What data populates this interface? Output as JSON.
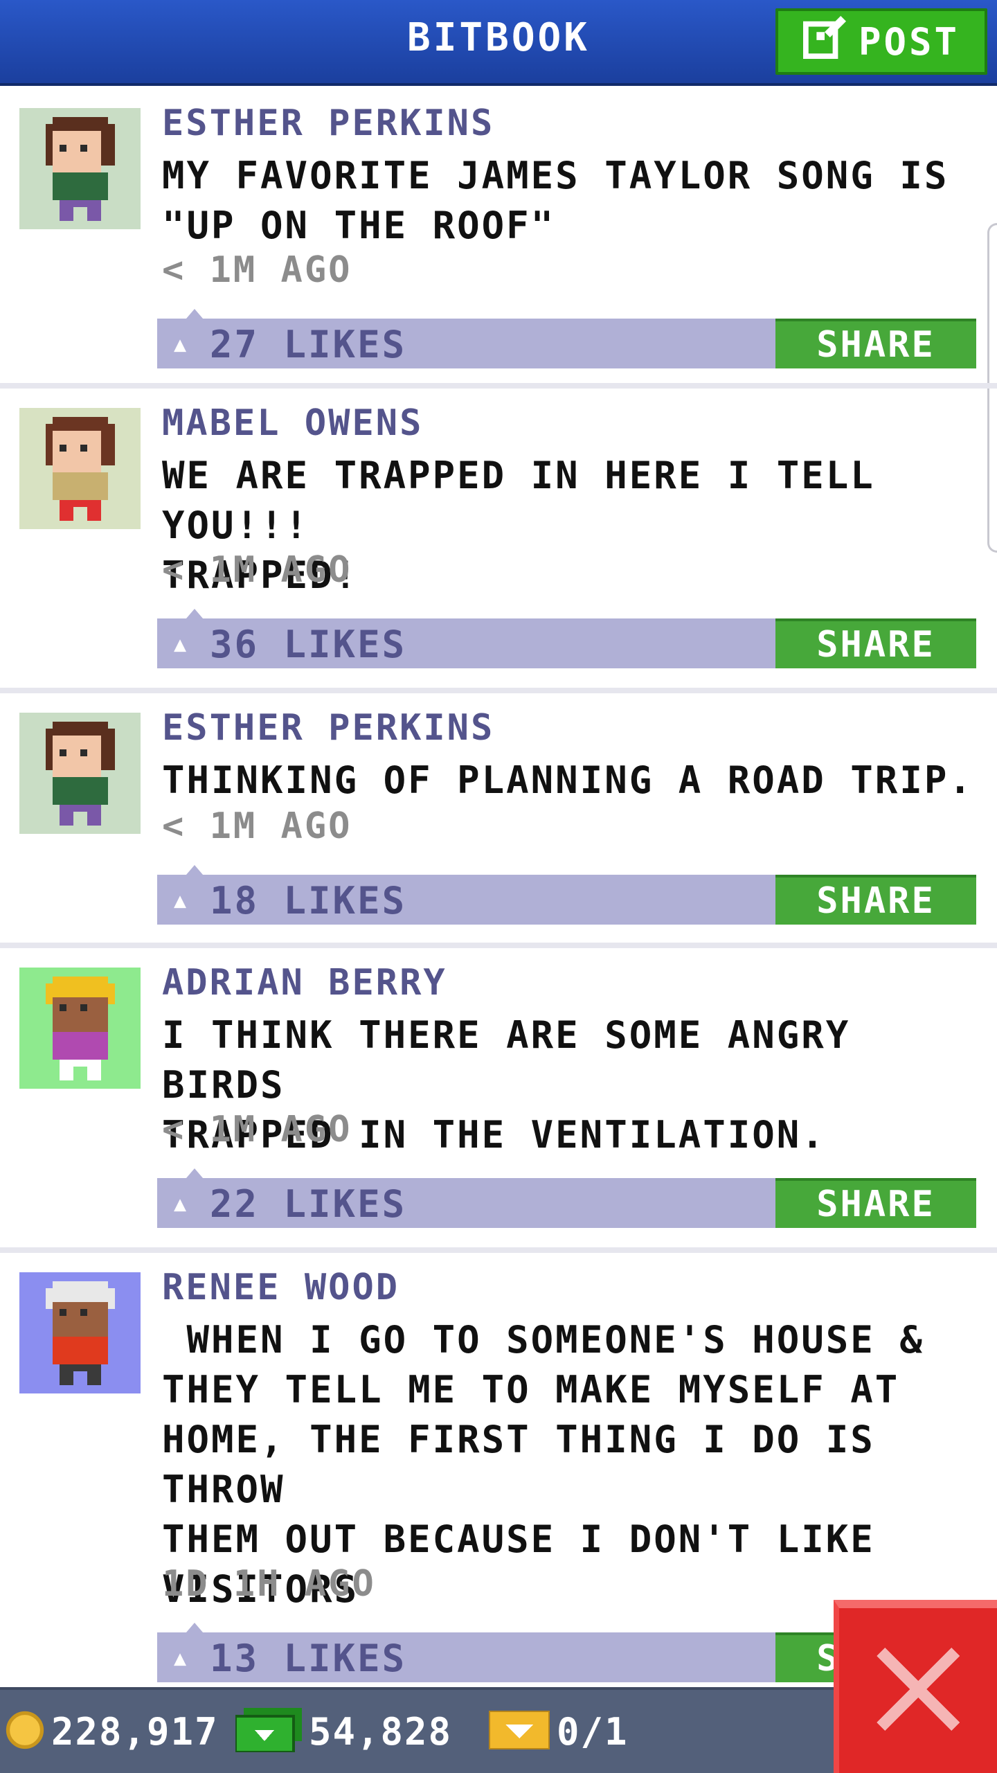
{
  "header": {
    "title": "BITBOOK",
    "post_label": "POST"
  },
  "posts": [
    {
      "author": "ESTHER PERKINS",
      "message": "MY FAVORITE JAMES TAYLOR SONG IS\n\"UP ON THE ROOF\"",
      "time": "< 1M AGO",
      "likes": "27 LIKES",
      "share_label": "SHARE"
    },
    {
      "author": "MABEL OWENS",
      "message": "WE ARE TRAPPED IN HERE I TELL YOU!!!\nTRAPPED!",
      "time": "< 1M AGO",
      "likes": "36 LIKES",
      "share_label": "SHARE"
    },
    {
      "author": "ESTHER PERKINS",
      "message": "THINKING OF PLANNING A ROAD TRIP.",
      "time": "< 1M AGO",
      "likes": "18 LIKES",
      "share_label": "SHARE"
    },
    {
      "author": "ADRIAN BERRY",
      "message": "I THINK THERE ARE SOME ANGRY BIRDS\nTRAPPED IN THE VENTILATION.",
      "time": "< 1M AGO",
      "likes": "22 LIKES",
      "share_label": "SHARE"
    },
    {
      "author": "RENEE WOOD",
      "message": " WHEN I GO TO SOMEONE'S HOUSE &\nTHEY TELL ME TO MAKE MYSELF AT\nHOME, THE FIRST THING I DO IS THROW\nTHEM OUT BECAUSE I DON'T LIKE\nVISITORS",
      "time": "1D 1H AGO",
      "likes": "13 LIKES",
      "share_label": "SHARE"
    }
  ],
  "status_bar": {
    "coins": "228,917",
    "bux": "54,828",
    "tickets": "0/1"
  },
  "colors": {
    "header": "#1b3f9e",
    "post_button": "#35b41f",
    "share_button": "#47a83a",
    "like_bar": "#b0b0d6",
    "author_text": "#54548c",
    "close_button": "#e02727",
    "status_bar": "#53607a"
  },
  "icons": {
    "post": "edit-icon",
    "like": "thumbs-up-icon",
    "coin": "coin-icon",
    "bux": "bux-icon",
    "ticket": "ticket-icon",
    "close": "close-icon"
  }
}
